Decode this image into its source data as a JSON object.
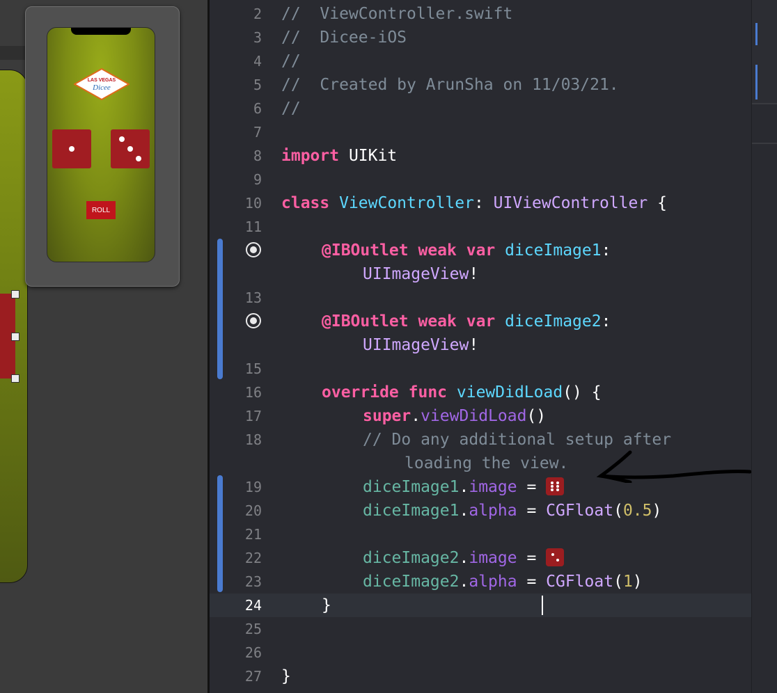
{
  "storyboard": {
    "logo_line1": "LAS VEGAS",
    "logo_line2": "Dicee",
    "roll_button": "ROLL"
  },
  "editor": {
    "current_line": "24",
    "lines": [
      {
        "num": "2",
        "text": "//  ViewController.swift"
      },
      {
        "num": "3",
        "text": "//  Dicee-iOS"
      },
      {
        "num": "4",
        "text": "//"
      },
      {
        "num": "5",
        "text": "//  Created by ArunSha on 11/03/21."
      },
      {
        "num": "6",
        "text": "//"
      },
      {
        "num": "7",
        "text": ""
      },
      {
        "num": "8",
        "text": "import UIKit"
      },
      {
        "num": "9",
        "text": ""
      },
      {
        "num": "10",
        "text": "class ViewController: UIViewController {"
      },
      {
        "num": "11",
        "text": ""
      },
      {
        "num": "",
        "text": "@IBOutlet weak var diceImage1: UIImageView!"
      },
      {
        "num": "13",
        "text": ""
      },
      {
        "num": "",
        "text": "@IBOutlet weak var diceImage2: UIImageView!"
      },
      {
        "num": "15",
        "text": ""
      },
      {
        "num": "16",
        "text": "override func viewDidLoad() {"
      },
      {
        "num": "17",
        "text": "super.viewDidLoad()"
      },
      {
        "num": "18",
        "text": "// Do any additional setup after loading the view."
      },
      {
        "num": "19",
        "text": "diceImage1.image = [dice]"
      },
      {
        "num": "20",
        "text": "diceImage1.alpha = CGFloat(0.5)"
      },
      {
        "num": "21",
        "text": ""
      },
      {
        "num": "22",
        "text": "diceImage2.image = [dice]"
      },
      {
        "num": "23",
        "text": "diceImage2.alpha = CGFloat(1)"
      },
      {
        "num": "24",
        "text": "}"
      },
      {
        "num": "25",
        "text": ""
      },
      {
        "num": "26",
        "text": ""
      },
      {
        "num": "27",
        "text": "}"
      }
    ]
  },
  "tokens": {
    "l2": "//  ViewController.swift",
    "l3": "//  Dicee-iOS",
    "l4": "//",
    "l5": "//  Created by ArunSha on 11/03/21.",
    "l6": "//",
    "import_kw": "import",
    "uikit": " UIKit",
    "class_kw": "class",
    "class_name": " ViewController",
    "colon": ": ",
    "superclass": "UIViewController",
    "brace_open": " {",
    "iboutlet": "@IBOutlet",
    "weak": " weak",
    "var": " var",
    "dice1": " diceImage1",
    "dice2": " diceImage2",
    "colon2": ":",
    "uiimageview": "UIImageView",
    "bang": "!",
    "override": "override",
    "func": " func",
    "viewdidload": " viewDidLoad",
    "parens_brace": "() {",
    "super_kw": "super",
    "dot": ".",
    "viewdidload2": "viewDidLoad",
    "parens": "()",
    "comment1": "// Do any additional setup after",
    "comment2": "loading the view.",
    "d1": "diceImage1",
    "d2": "diceImage2",
    "image_prop": "image",
    "alpha_prop": "alpha",
    "eq": " = ",
    "cgfloat": "CGFloat",
    "lp": "(",
    "rp": ")",
    "num05": "0.5",
    "num1": "1",
    "close_brace": "}"
  },
  "colors": {
    "keyword": "#fc5fa3",
    "type": "#5dd8ff",
    "comment": "#7f8c98",
    "change_bar": "#4a7bd0",
    "die_red": "#9b1d20"
  },
  "icons": [
    "outlet-connected-icon",
    "arrow-annotation",
    "dice-literal-icon"
  ]
}
